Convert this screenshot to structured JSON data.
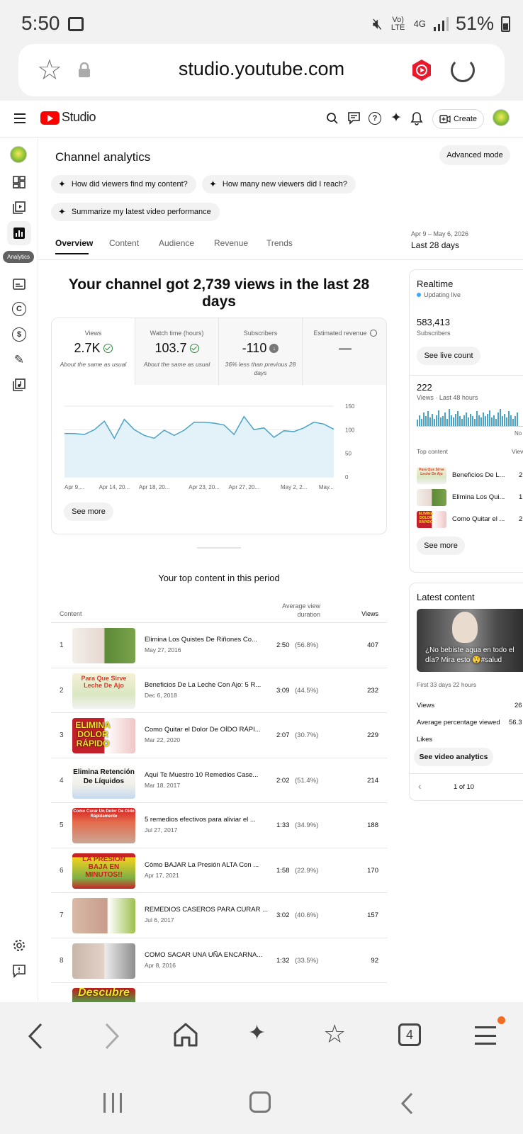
{
  "status_bar": {
    "time": "5:50",
    "network": "Vo) LTE",
    "network2": "4G",
    "battery": "51%"
  },
  "browser": {
    "url": "studio.youtube.com",
    "tab_count": "4"
  },
  "app": {
    "product": "Studio",
    "create_label": "Create"
  },
  "sidebar": {
    "tooltip": "Analytics"
  },
  "header": {
    "title": "Channel analytics",
    "advanced_mode": "Advanced mode"
  },
  "chips": [
    "How did viewers find my content?",
    "How many new viewers did I reach?",
    "Summarize my latest video performance"
  ],
  "tabs": [
    "Overview",
    "Content",
    "Audience",
    "Revenue",
    "Trends"
  ],
  "date_range": {
    "range": "Apr 9 – May 6, 2026",
    "label": "Last 28 days"
  },
  "summary_title": "Your channel got 2,739 views in the last 28 days",
  "metrics": [
    {
      "label": "Views",
      "value": "2.7K",
      "note": "About the same as usual"
    },
    {
      "label": "Watch time (hours)",
      "value": "103.7",
      "note": "About the same as usual"
    },
    {
      "label": "Subscribers",
      "value": "-110",
      "note": "36% less than previous 28 days"
    },
    {
      "label": "Estimated revenue",
      "value": "—",
      "note": ""
    }
  ],
  "chart_data": {
    "type": "area",
    "x": [
      "Apr 9",
      "Apr 10",
      "Apr 11",
      "Apr 12",
      "Apr 13",
      "Apr 14",
      "Apr 15",
      "Apr 16",
      "Apr 17",
      "Apr 18",
      "Apr 19",
      "Apr 20",
      "Apr 21",
      "Apr 22",
      "Apr 23",
      "Apr 24",
      "Apr 25",
      "Apr 26",
      "Apr 27",
      "Apr 28",
      "Apr 29",
      "Apr 30",
      "May 1",
      "May 2",
      "May 3",
      "May 4",
      "May 5",
      "May 6"
    ],
    "values": [
      92,
      92,
      90,
      100,
      118,
      82,
      122,
      100,
      88,
      82,
      99,
      88,
      99,
      116,
      116,
      114,
      110,
      90,
      128,
      100,
      104,
      84,
      98,
      96,
      104,
      116,
      112,
      101
    ],
    "x_tick_labels": [
      "Apr 9,...",
      "Apr 14, 20...",
      "Apr 18, 20...",
      "Apr 23, 20...",
      "Apr 27, 20...",
      "May 2, 2...",
      "May..."
    ],
    "y_ticks": [
      "0",
      "50",
      "100",
      "150"
    ],
    "ylim": [
      0,
      150
    ],
    "grid": true
  },
  "see_more": "See more",
  "top_content": {
    "title": "Your top content in this period",
    "col_content": "Content",
    "col_avd": "Average view duration",
    "col_views": "Views",
    "rows": [
      {
        "rank": "1",
        "title": "Elimina Los Quistes De Riñones Co...",
        "date": "May 27, 2016",
        "duration": "2:50",
        "percent": "(56.8%)",
        "views": "407"
      },
      {
        "rank": "2",
        "title": "Beneficios De La Leche Con Ajo: 5 R...",
        "date": "Dec 6, 2018",
        "duration": "3:09",
        "percent": "(44.5%)",
        "views": "232",
        "thumb_text": "Para Que Sirve Leche De Ajo"
      },
      {
        "rank": "3",
        "title": "Como Quitar el Dolor De OÍDO RÁPI...",
        "date": "Mar 22, 2020",
        "duration": "2:07",
        "percent": "(30.7%)",
        "views": "229",
        "thumb_text": "ELIMINA DOLOR RÁPIDO"
      },
      {
        "rank": "4",
        "title": "Aquí Te Muestro 10 Remedios Case...",
        "date": "Mar 18, 2017",
        "duration": "2:02",
        "percent": "(51.4%)",
        "views": "214",
        "thumb_text": "Elimina Retención De Líquidos"
      },
      {
        "rank": "5",
        "title": "5 remedios efectivos para aliviar el ...",
        "date": "Jul 27, 2017",
        "duration": "1:33",
        "percent": "(34.9%)",
        "views": "188",
        "thumb_text": "Como Curar Un Dolor De Oído Rápidamente"
      },
      {
        "rank": "6",
        "title": "Cómo BAJAR La Presión ALTA Con ...",
        "date": "Apr 17, 2021",
        "duration": "1:58",
        "percent": "(22.9%)",
        "views": "170",
        "thumb_text": "LA PRESIÓN BAJA EN MINUTOS!!"
      },
      {
        "rank": "7",
        "title": "REMEDIOS CASEROS PARA CURAR ...",
        "date": "Jul 6, 2017",
        "duration": "3:02",
        "percent": "(40.6%)",
        "views": "157"
      },
      {
        "rank": "8",
        "title": "COMO SACAR UNA UÑA ENCARNA...",
        "date": "Apr 8, 2016",
        "duration": "1:32",
        "percent": "(33.5%)",
        "views": "92"
      },
      {
        "rank": "9",
        "title": "",
        "date": "",
        "duration": "",
        "percent": "",
        "views": "",
        "thumb_text": "Descubre"
      }
    ]
  },
  "realtime": {
    "title": "Realtime",
    "status": "Updating live",
    "subs": "583,413",
    "subs_label": "Subscribers",
    "see_live": "See live count",
    "views": "222",
    "views_label": "Views · Last 48 hours",
    "now_label": "No",
    "bars": [
      5,
      9,
      6,
      11,
      8,
      12,
      7,
      10,
      6,
      9,
      13,
      7,
      8,
      11,
      6,
      14,
      9,
      7,
      10,
      12,
      8,
      6,
      9,
      11,
      7,
      10,
      8,
      6,
      12,
      9,
      7,
      11,
      8,
      10,
      13,
      7,
      9,
      6,
      11,
      14,
      8,
      10,
      7,
      12,
      9,
      6,
      8,
      11
    ],
    "top_content_label": "Top content",
    "views_col": "View",
    "items": [
      {
        "title": "Beneficios De L...",
        "value": "2",
        "thumb_text": "Para Que Sirve Leche De Ajo"
      },
      {
        "title": "Elimina Los Qui...",
        "value": "1"
      },
      {
        "title": "Como Quitar el ...",
        "value": "2",
        "thumb_text": "ELIMINA DOLOR RÁPIDO"
      }
    ],
    "see_more": "See more"
  },
  "latest": {
    "title": "Latest content",
    "caption": "¿No bebiste agua en todo el día? Mira esto 😲#salud",
    "period": "First 33 days 22 hours",
    "stats": [
      {
        "label": "Views",
        "value": "26"
      },
      {
        "label": "Average percentage viewed",
        "value": "56.3"
      },
      {
        "label": "Likes",
        "value": ""
      }
    ],
    "button": "See video analytics",
    "pager": "1 of 10"
  },
  "colors": {
    "brand": "#ff0000",
    "chart_line": "#4aa3c7",
    "chart_fill": "#e3f2f8",
    "ok": "#2b8a3e",
    "live": "#3ea6ff"
  }
}
